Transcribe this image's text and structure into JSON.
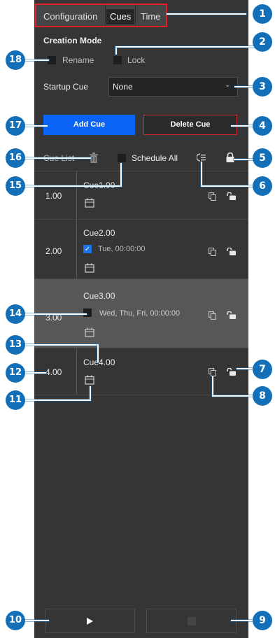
{
  "tabs": [
    {
      "label": "Configuration"
    },
    {
      "label": "Cues"
    },
    {
      "label": "Time"
    }
  ],
  "creation_mode": {
    "title": "Creation Mode",
    "rename_label": "Rename",
    "lock_label": "Lock",
    "rename_checked": false,
    "lock_checked": false
  },
  "startup_cue": {
    "label": "Startup Cue",
    "value": "None"
  },
  "buttons": {
    "add_cue": "Add Cue",
    "delete_cue": "Delete Cue"
  },
  "cue_list": {
    "label": "Cue List",
    "schedule_all_label": "Schedule All",
    "rows": [
      {
        "number": "1.00",
        "name": "Cue1.00",
        "schedule_checked": false,
        "schedule_text": "",
        "selected": false
      },
      {
        "number": "2.00",
        "name": "Cue2.00",
        "schedule_checked": true,
        "schedule_text": "Tue,  00:00:00",
        "selected": false
      },
      {
        "number": "3.00",
        "name": "Cue3.00",
        "schedule_checked": false,
        "schedule_text": "Wed, Thu, Fri,  00:00:00",
        "selected": true
      },
      {
        "number": "4.00",
        "name": "Cue4.00",
        "schedule_checked": false,
        "schedule_text": "",
        "selected": false
      }
    ]
  },
  "callouts": [
    "1",
    "2",
    "3",
    "4",
    "5",
    "6",
    "7",
    "8",
    "9",
    "10",
    "11",
    "12",
    "13",
    "14",
    "15",
    "16",
    "17",
    "18"
  ],
  "colors": {
    "panel": "#353535",
    "accent_blue": "#0a63f5",
    "delete_red": "#d22b2b",
    "callout_blue": "#1370b8",
    "highlight_red": "#e01f2a"
  }
}
